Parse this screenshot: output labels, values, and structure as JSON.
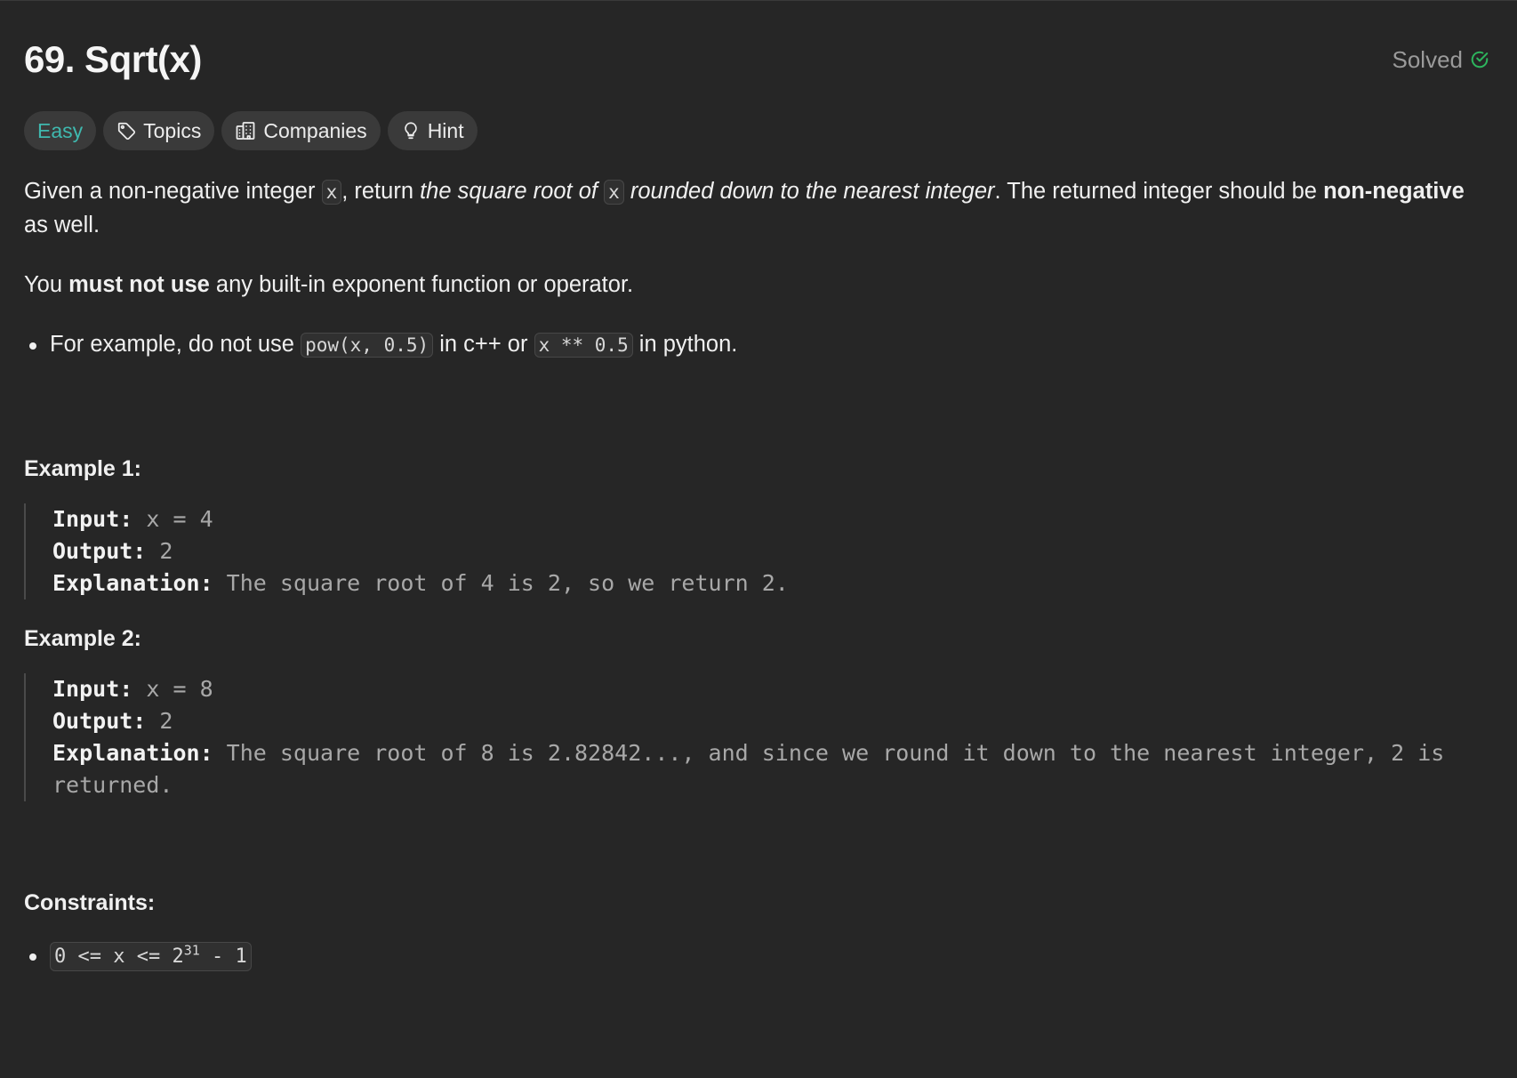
{
  "problem": {
    "title": "69. Sqrt(x)",
    "status": "Solved",
    "status_color": "#2db55d",
    "difficulty_color": "#3fb8ae"
  },
  "tags": {
    "difficulty": "Easy",
    "topics": "Topics",
    "companies": "Companies",
    "hint": "Hint"
  },
  "description": {
    "p1_a": "Given a non-negative integer ",
    "code_x": "x",
    "p1_b": ", return ",
    "p1_em1": "the square root of",
    "p1_c": " ",
    "p1_d": " ",
    "p1_em2": "rounded down to the nearest integer",
    "p1_e": ". The returned integer should be ",
    "p1_bold": "non-negative",
    "p1_f": " as well.",
    "p2_a": "You ",
    "p2_bold": "must not use",
    "p2_b": " any built-in exponent function or operator.",
    "bullet_a": "For example, do not use ",
    "bullet_code1": "pow(x, 0.5)",
    "bullet_b": " in c++ or ",
    "bullet_code2": "x ** 0.5",
    "bullet_c": " in python."
  },
  "examples": [
    {
      "title": "Example 1:",
      "input_label": "Input:",
      "input_value": " x = 4",
      "output_label": "Output:",
      "output_value": " 2",
      "explanation_label": "Explanation:",
      "explanation_value": " The square root of 4 is 2, so we return 2."
    },
    {
      "title": "Example 2:",
      "input_label": "Input:",
      "input_value": " x = 8",
      "output_label": "Output:",
      "output_value": " 2",
      "explanation_label": "Explanation:",
      "explanation_value": " The square root of 8 is 2.82842..., and since we round it down to the nearest integer, 2 is returned."
    }
  ],
  "constraints": {
    "title": "Constraints:",
    "c1_a": "0 <= x <= 2",
    "c1_sup": "31",
    "c1_b": " - 1"
  }
}
